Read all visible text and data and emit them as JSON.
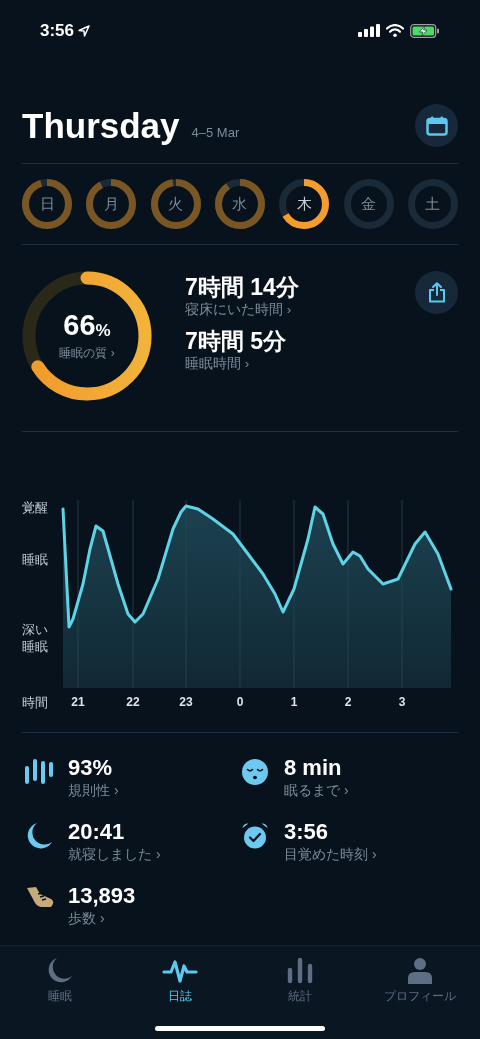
{
  "status_bar": {
    "time": "3:56"
  },
  "header": {
    "title": "Thursday",
    "date_range": "4–5 Mar"
  },
  "days": [
    {
      "label": "日",
      "level": 0.95,
      "selected": false
    },
    {
      "label": "月",
      "level": 0.92,
      "selected": false
    },
    {
      "label": "火",
      "level": 0.97,
      "selected": false
    },
    {
      "label": "水",
      "level": 0.9,
      "selected": false
    },
    {
      "label": "木",
      "level": 0.66,
      "selected": true
    },
    {
      "label": "金",
      "selected": false
    },
    {
      "label": "土",
      "selected": false
    }
  ],
  "quality": {
    "value": "66",
    "unit": "%",
    "label": "睡眠の質 ›",
    "level": 0.66
  },
  "durations": [
    {
      "value": "7時間 14分",
      "label": "寝床にいた時間 ›"
    },
    {
      "value": "7時間 5分",
      "label": "睡眠時間 ›"
    }
  ],
  "chart": {
    "y_labels": [
      "覚醒",
      "睡眠",
      "深い睡眠"
    ],
    "x_title": "時間",
    "x_labels": [
      "21",
      "22",
      "23",
      "0",
      "1",
      "2",
      "3"
    ]
  },
  "stats": [
    {
      "kind": "regularity",
      "value": "93%",
      "label": "規則性 ›"
    },
    {
      "kind": "fall_asleep",
      "value": "8 min",
      "label": "眠るまで ›"
    },
    {
      "kind": "bedtime",
      "value": "20:41",
      "label": "就寝しました ›"
    },
    {
      "kind": "wake",
      "value": "3:56",
      "label": "目覚めた時刻 ›"
    },
    {
      "kind": "steps",
      "value": "13,893",
      "label": "歩数 ›"
    }
  ],
  "tabs": [
    {
      "kind": "sleep",
      "label": "睡眠",
      "selected": false
    },
    {
      "kind": "journal",
      "label": "日誌",
      "selected": true
    },
    {
      "kind": "stats",
      "label": "統計",
      "selected": false
    },
    {
      "kind": "profile",
      "label": "プロフィール",
      "selected": false
    }
  ]
}
